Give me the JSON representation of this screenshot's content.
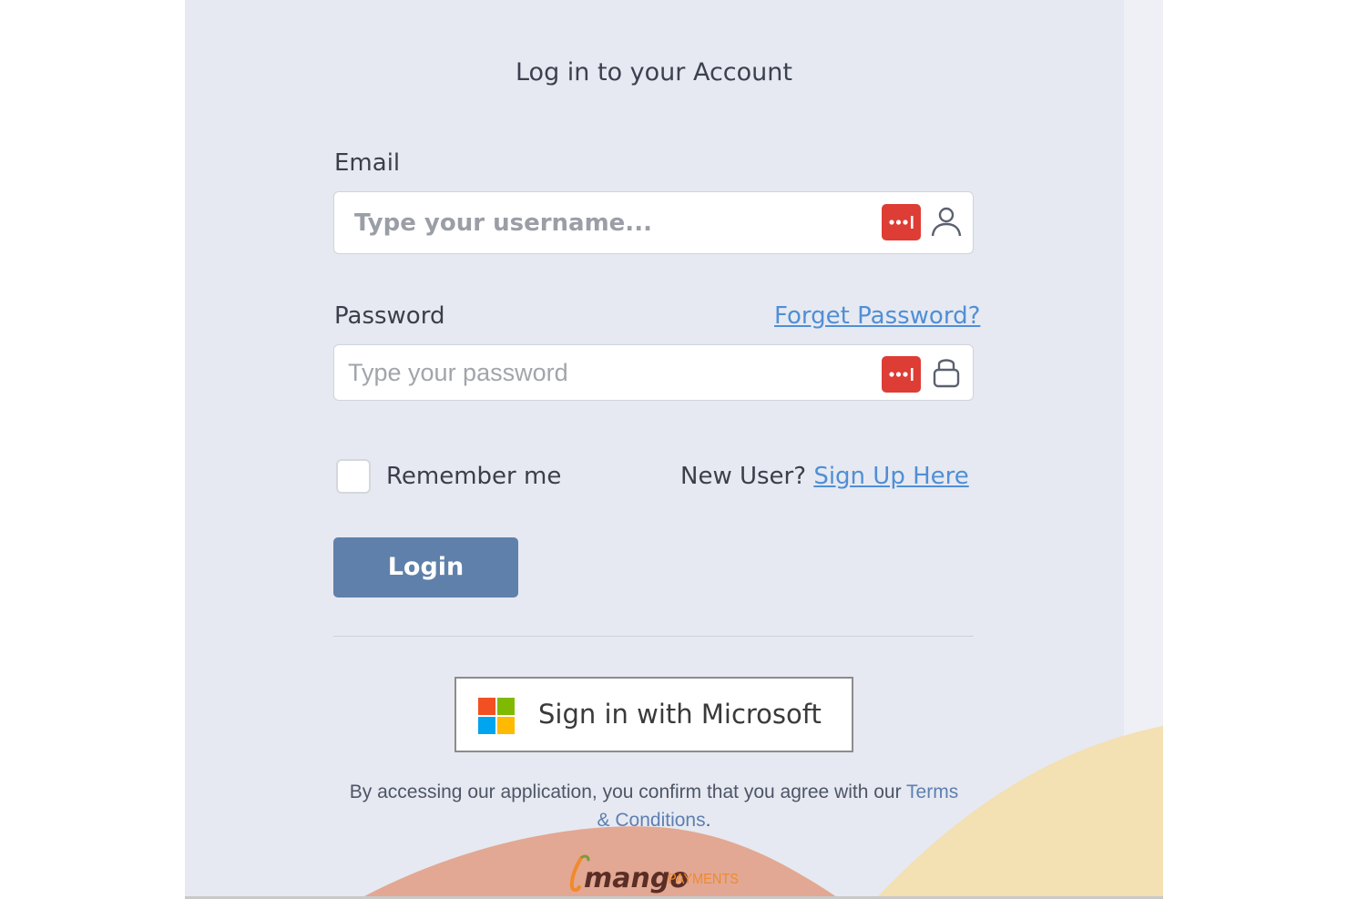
{
  "page": {
    "title": "Log in to your Account"
  },
  "email": {
    "label": "Email",
    "placeholder": "Type your username...",
    "value": "",
    "password_manager_icon": "lastpass-icon",
    "icon": "user-icon"
  },
  "password": {
    "label": "Password",
    "forgot_link": "Forget Password?",
    "placeholder": "Type your password",
    "value": "",
    "password_manager_icon": "lastpass-icon",
    "icon": "lock-icon"
  },
  "remember": {
    "label": "Remember me",
    "checked": false
  },
  "signup": {
    "prompt": "New User?",
    "link": "Sign Up Here"
  },
  "login_button": "Login",
  "microsoft_button": {
    "label": "Sign in with Microsoft",
    "icon": "microsoft-logo-icon"
  },
  "terms": {
    "text": "By accessing our application, you confirm that you agree with our ",
    "link": "Terms & Conditions",
    "end": "."
  },
  "brand": {
    "name": "mango",
    "suffix": "PAYMENTS"
  },
  "colors": {
    "panel_bg": "#e6e9f1",
    "accent": "#5f80aa",
    "link": "#4f8fd6",
    "password_manager": "#dd3d35",
    "decor_salmon": "#e2a893",
    "decor_sand": "#f3e0b3",
    "brand_orange": "#f08a2c"
  }
}
